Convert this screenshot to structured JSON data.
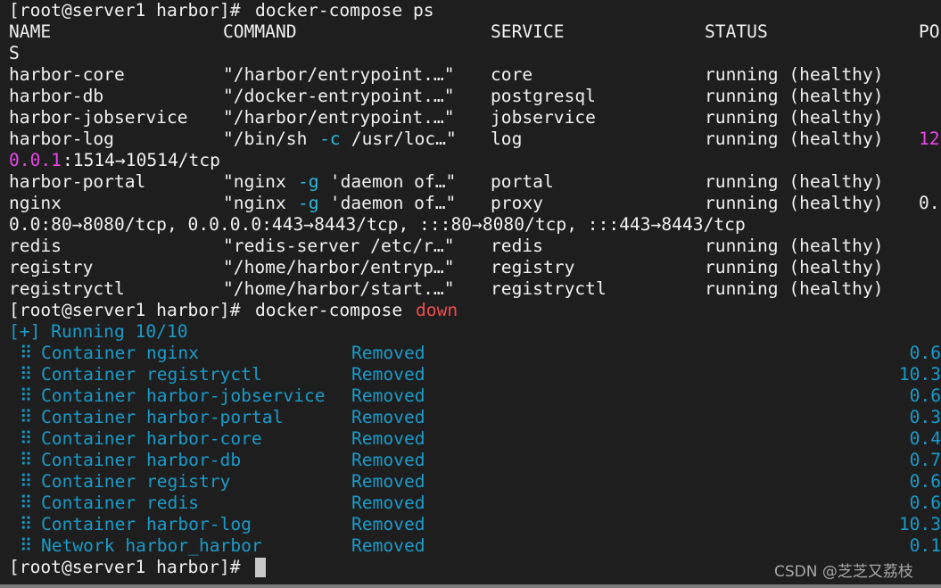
{
  "colors": {
    "background": "#1e1e1e",
    "text": "#f0f0f0",
    "flag": "#29b8db",
    "progress": "#1a9bc9",
    "address": "#e845e8",
    "down": "#f14c4c"
  },
  "prompt": "[root@server1 harbor]# ",
  "ps": {
    "command": "docker-compose ps",
    "headers": [
      "NAME",
      "COMMAND",
      "SERVICE",
      "STATUS",
      "PO"
    ],
    "header_wrap": "S",
    "rows": [
      {
        "name": "harbor-core",
        "command": [
          [
            "\"/harbor/entrypoint.…\"",
            "default"
          ]
        ],
        "service": "core",
        "status": "running (healthy)",
        "ports": ""
      },
      {
        "name": "harbor-db",
        "command": [
          [
            "\"/docker-entrypoint.…\"",
            "default"
          ]
        ],
        "service": "postgresql",
        "status": "running (healthy)",
        "ports": ""
      },
      {
        "name": "harbor-jobservice",
        "command": [
          [
            "\"/harbor/entrypoint.…\"",
            "default"
          ]
        ],
        "service": "jobservice",
        "status": "running (healthy)",
        "ports": ""
      },
      {
        "name": "harbor-log",
        "command": [
          [
            "\"/bin/sh ",
            "default"
          ],
          [
            "-c",
            "cyan"
          ],
          [
            " /usr/loc…\"",
            "default"
          ]
        ],
        "service": "log",
        "status": "running (healthy)",
        "ports": "12",
        "ports_color": "magenta",
        "wrap": [
          [
            "0.0.1",
            "magenta"
          ],
          [
            ":1514→10514/tcp",
            "default"
          ]
        ]
      },
      {
        "name": "harbor-portal",
        "command": [
          [
            "\"nginx ",
            "default"
          ],
          [
            "-g",
            "cyan"
          ],
          [
            " 'daemon of…\"",
            "default"
          ]
        ],
        "service": "portal",
        "status": "running (healthy)",
        "ports": ""
      },
      {
        "name": "nginx",
        "command": [
          [
            "\"nginx ",
            "default"
          ],
          [
            "-g",
            "cyan"
          ],
          [
            " 'daemon of…\"",
            "default"
          ]
        ],
        "service": "proxy",
        "status": "running (healthy)",
        "ports": "0.",
        "ports_color": "default",
        "wrap": [
          [
            "0.0:80→8080/tcp, 0.0.0.0:443→8443/tcp, :::80→8080/tcp, :::443→8443/tcp",
            "default"
          ]
        ]
      },
      {
        "name": "redis",
        "command": [
          [
            "\"redis-server /etc/r…\"",
            "default"
          ]
        ],
        "service": "redis",
        "status": "running (healthy)",
        "ports": ""
      },
      {
        "name": "registry",
        "command": [
          [
            "\"/home/harbor/entryp…\"",
            "default"
          ]
        ],
        "service": "registry",
        "status": "running (healthy)",
        "ports": ""
      },
      {
        "name": "registryctl",
        "command": [
          [
            "\"/home/harbor/start.…\"",
            "default"
          ]
        ],
        "service": "registryctl",
        "status": "running (healthy)",
        "ports": ""
      }
    ]
  },
  "down": {
    "command": "docker-compose ",
    "command_arg": "down",
    "progress": "[+] Running 10/10",
    "bullet": "⠿",
    "items": [
      {
        "label": "Container nginx",
        "status": "Removed",
        "time": "0.6"
      },
      {
        "label": "Container registryctl",
        "status": "Removed",
        "time": "10.3"
      },
      {
        "label": "Container harbor-jobservice",
        "status": "Removed",
        "time": "0.6"
      },
      {
        "label": "Container harbor-portal",
        "status": "Removed",
        "time": "0.3"
      },
      {
        "label": "Container harbor-core",
        "status": "Removed",
        "time": "0.4"
      },
      {
        "label": "Container harbor-db",
        "status": "Removed",
        "time": "0.7"
      },
      {
        "label": "Container registry",
        "status": "Removed",
        "time": "0.6"
      },
      {
        "label": "Container redis",
        "status": "Removed",
        "time": "0.6"
      },
      {
        "label": "Container harbor-log",
        "status": "Removed",
        "time": "10.3"
      },
      {
        "label": "Network harbor_harbor",
        "status": "Removed",
        "time": "0.1"
      }
    ]
  },
  "watermark": "CSDN @芝芝又荔枝"
}
